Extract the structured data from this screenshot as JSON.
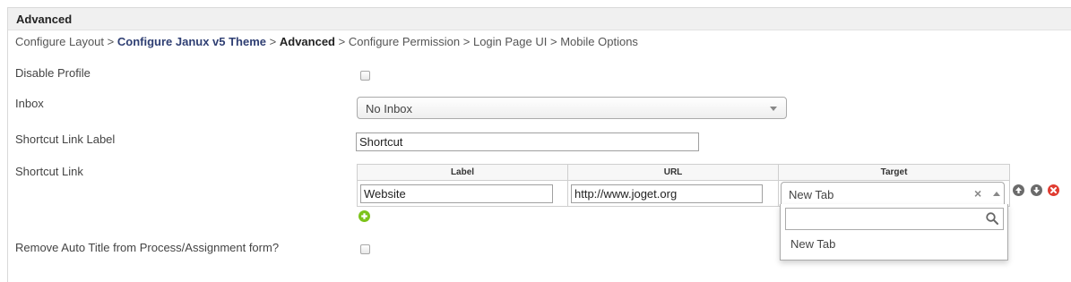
{
  "panel": {
    "title": "Advanced"
  },
  "breadcrumb": {
    "items": [
      "Configure Layout",
      "Configure Janux v5 Theme",
      "Advanced",
      "Configure Permission",
      "Login Page UI",
      "Mobile Options"
    ],
    "separator": ">"
  },
  "fields": {
    "disable_profile": {
      "label": "Disable Profile",
      "checked": false
    },
    "inbox": {
      "label": "Inbox",
      "selected": "No Inbox"
    },
    "shortcut_link_label": {
      "label": "Shortcut Link Label",
      "value": "Shortcut"
    },
    "shortcut_link": {
      "label": "Shortcut Link",
      "columns": [
        "Label",
        "URL",
        "Target"
      ],
      "rows": [
        {
          "label": "Website",
          "url": "http://www.joget.org",
          "target": "New Tab"
        }
      ],
      "dropdown": {
        "search_placeholder": "",
        "options": [
          "New Tab"
        ]
      }
    },
    "remove_auto_title": {
      "label": "Remove Auto Title from Process/Assignment form?",
      "checked": false
    }
  },
  "icons": {
    "row_actions": [
      "move-up-icon",
      "move-down-icon",
      "delete-icon"
    ],
    "add": "add-icon",
    "search": "search-icon"
  },
  "colors": {
    "breadcrumb_link": "#2f3f73",
    "add_green": "#7cc31a",
    "delete_red": "#e03c31",
    "move_gray": "#6b6b6b"
  }
}
